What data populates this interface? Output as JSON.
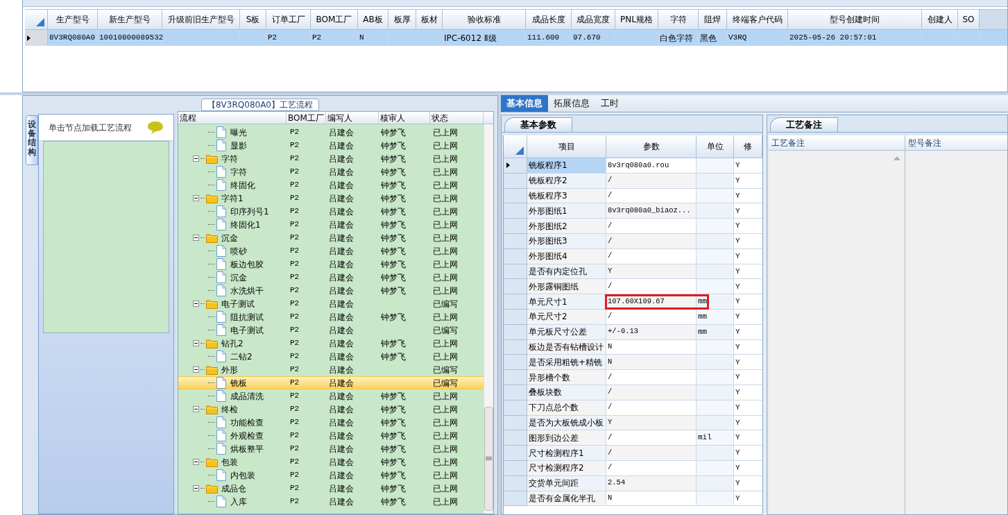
{
  "production_table": {
    "columns": [
      "生产型号",
      "新生产型号",
      "升级前旧生产型号",
      "S板",
      "订单工厂",
      "BOM工厂",
      "AB板",
      "板厚",
      "板材",
      "验收标准",
      "成品长度",
      "成品宽度",
      "PNL规格",
      "字符",
      "阻焊",
      "终端客户代码",
      "型号创建时间",
      "创建人",
      "SO"
    ],
    "rows": [
      {
        "selected": true,
        "cells": [
          "8V3RQ080A0",
          "10010800089532",
          null,
          null,
          "P2",
          "P2",
          "N",
          null,
          null,
          "IPC-6012 Ⅱ级",
          "111.600",
          "97.670",
          null,
          "白色字符",
          "黑色",
          "V3RQ",
          "2025-05-26 20:57:01",
          null,
          null
        ]
      }
    ]
  },
  "process_panel": {
    "title": "【8V3RQ080A0】工艺流程",
    "side_tab": "设备结构",
    "hint": "单击节点加载工艺流程",
    "tree_columns": [
      "流程",
      "BOM工厂",
      "编写人",
      "核审人",
      "状态"
    ],
    "tree": [
      {
        "kind": "step",
        "label": "曝光",
        "bom": "P2",
        "author": "吕建会",
        "reviewer": "钟梦飞",
        "status": "已上网",
        "selected": false
      },
      {
        "kind": "step",
        "label": "显影",
        "bom": "P2",
        "author": "吕建会",
        "reviewer": "钟梦飞",
        "status": "已上网",
        "selected": false
      },
      {
        "kind": "folder",
        "label": "字符",
        "bom": "P2",
        "author": "吕建会",
        "reviewer": "钟梦飞",
        "status": "已上网",
        "selected": false,
        "expanded": true,
        "children": [
          {
            "kind": "step",
            "label": "字符",
            "bom": "P2",
            "author": "吕建会",
            "reviewer": "钟梦飞",
            "status": "已上网",
            "selected": false
          },
          {
            "kind": "step",
            "label": "终固化",
            "bom": "P2",
            "author": "吕建会",
            "reviewer": "钟梦飞",
            "status": "已上网",
            "selected": false
          }
        ]
      },
      {
        "kind": "folder",
        "label": "字符1",
        "bom": "P2",
        "author": "吕建会",
        "reviewer": "钟梦飞",
        "status": "已上网",
        "selected": false,
        "expanded": true,
        "children": [
          {
            "kind": "step",
            "label": "印序列号1",
            "bom": "P2",
            "author": "吕建会",
            "reviewer": "钟梦飞",
            "status": "已上网",
            "selected": false
          },
          {
            "kind": "step",
            "label": "终固化1",
            "bom": "P2",
            "author": "吕建会",
            "reviewer": "钟梦飞",
            "status": "已上网",
            "selected": false
          }
        ]
      },
      {
        "kind": "folder",
        "label": "沉金",
        "bom": "P2",
        "author": "吕建会",
        "reviewer": "钟梦飞",
        "status": "已上网",
        "selected": false,
        "expanded": true,
        "children": [
          {
            "kind": "step",
            "label": "喷砂",
            "bom": "P2",
            "author": "吕建会",
            "reviewer": "钟梦飞",
            "status": "已上网",
            "selected": false
          },
          {
            "kind": "step",
            "label": "板边包胶",
            "bom": "P2",
            "author": "吕建会",
            "reviewer": "钟梦飞",
            "status": "已上网",
            "selected": false
          },
          {
            "kind": "step",
            "label": "沉金",
            "bom": "P2",
            "author": "吕建会",
            "reviewer": "钟梦飞",
            "status": "已上网",
            "selected": false
          },
          {
            "kind": "step",
            "label": "水洗烘干",
            "bom": "P2",
            "author": "吕建会",
            "reviewer": "钟梦飞",
            "status": "已上网",
            "selected": false
          }
        ]
      },
      {
        "kind": "folder",
        "label": "电子测试",
        "bom": "P2",
        "author": "吕建会",
        "status": "已编写",
        "selected": false,
        "expanded": true,
        "children": [
          {
            "kind": "step",
            "label": "阻抗测试",
            "bom": "P2",
            "author": "吕建会",
            "reviewer": "钟梦飞",
            "status": "已上网",
            "selected": false
          },
          {
            "kind": "step",
            "label": "电子测试",
            "bom": "P2",
            "author": "吕建会",
            "status": "已编写",
            "selected": false
          }
        ]
      },
      {
        "kind": "folder",
        "label": "钻孔2",
        "bom": "P2",
        "author": "吕建会",
        "reviewer": "钟梦飞",
        "status": "已上网",
        "selected": false,
        "expanded": true,
        "children": [
          {
            "kind": "step",
            "label": "二钻2",
            "bom": "P2",
            "author": "吕建会",
            "reviewer": "钟梦飞",
            "status": "已上网",
            "selected": false
          }
        ]
      },
      {
        "kind": "folder",
        "label": "外形",
        "bom": "P2",
        "author": "吕建会",
        "status": "已编写",
        "selected": false,
        "expanded": true,
        "children": [
          {
            "kind": "step",
            "label": "铣板",
            "bom": "P2",
            "author": "吕建会",
            "status": "已编写",
            "selected": true
          },
          {
            "kind": "step",
            "label": "成品清洗",
            "bom": "P2",
            "author": "吕建会",
            "reviewer": "钟梦飞",
            "status": "已上网",
            "selected": false
          }
        ]
      },
      {
        "kind": "folder",
        "label": "终检",
        "bom": "P2",
        "author": "吕建会",
        "reviewer": "钟梦飞",
        "status": "已上网",
        "selected": false,
        "expanded": true,
        "children": [
          {
            "kind": "step",
            "label": "功能检查",
            "bom": "P2",
            "author": "吕建会",
            "reviewer": "钟梦飞",
            "status": "已上网",
            "selected": false
          },
          {
            "kind": "step",
            "label": "外观检查",
            "bom": "P2",
            "author": "吕建会",
            "reviewer": "钟梦飞",
            "status": "已上网",
            "selected": false
          },
          {
            "kind": "step",
            "label": "烘板整平",
            "bom": "P2",
            "author": "吕建会",
            "reviewer": "钟梦飞",
            "status": "已上网",
            "selected": false
          }
        ]
      },
      {
        "kind": "folder",
        "label": "包装",
        "bom": "P2",
        "author": "吕建会",
        "reviewer": "钟梦飞",
        "status": "已上网",
        "selected": false,
        "expanded": true,
        "children": [
          {
            "kind": "step",
            "label": "内包装",
            "bom": "P2",
            "author": "吕建会",
            "reviewer": "钟梦飞",
            "status": "已上网",
            "selected": false
          }
        ]
      },
      {
        "kind": "folder",
        "label": "成品仓",
        "bom": "P2",
        "author": "吕建会",
        "reviewer": "钟梦飞",
        "status": "已上网",
        "selected": false,
        "expanded": true,
        "children": [
          {
            "kind": "step",
            "label": "入库",
            "bom": "P2",
            "author": "吕建会",
            "reviewer": "钟梦飞",
            "status": "已上网",
            "selected": false
          }
        ]
      }
    ]
  },
  "detail_tabs": [
    {
      "label": "基本信息",
      "selected": true
    },
    {
      "label": "拓展信息",
      "selected": false
    },
    {
      "label": "工时",
      "selected": false
    }
  ],
  "params_panel": {
    "tab": "基本参数",
    "columns": [
      "项目",
      "参数",
      "单位",
      "修"
    ],
    "rows": [
      {
        "item": "铣板程序1",
        "value": "8v3rq080a0.rou",
        "modified": "Y",
        "selected": true,
        "highlighted": false
      },
      {
        "item": "铣板程序2",
        "value": "/",
        "modified": "Y",
        "selected": false,
        "highlighted": false
      },
      {
        "item": "铣板程序3",
        "value": "/",
        "modified": "Y",
        "selected": false,
        "highlighted": false
      },
      {
        "item": "外形图纸1",
        "value": "8v3rq080a0_biaoz...",
        "modified": "Y",
        "selected": false,
        "highlighted": false
      },
      {
        "item": "外形图纸2",
        "value": "/",
        "modified": "Y",
        "selected": false,
        "highlighted": false
      },
      {
        "item": "外形图纸3",
        "value": "/",
        "modified": "Y",
        "selected": false,
        "highlighted": false
      },
      {
        "item": "外形图纸4",
        "value": "/",
        "modified": "Y",
        "selected": false,
        "highlighted": false
      },
      {
        "item": "是否有内定位孔",
        "value": "Y",
        "modified": "Y",
        "selected": false,
        "highlighted": false
      },
      {
        "item": "外形露铜图纸",
        "value": "/",
        "modified": "Y",
        "selected": false,
        "highlighted": false
      },
      {
        "item": "单元尺寸1",
        "value": "107.60X109.67",
        "unit": "mm",
        "modified": "Y",
        "selected": false,
        "highlighted": true
      },
      {
        "item": "单元尺寸2",
        "value": "/",
        "unit": "mm",
        "modified": "Y",
        "selected": false,
        "highlighted": false
      },
      {
        "item": "单元板尺寸公差",
        "value": "+/-0.13",
        "unit": "mm",
        "modified": "Y",
        "selected": false,
        "highlighted": false
      },
      {
        "item": "板边是否有钻槽设计",
        "value": "N",
        "modified": "Y",
        "selected": false,
        "highlighted": false
      },
      {
        "item": "是否采用粗铣+精铣",
        "value": "N",
        "modified": "Y",
        "selected": false,
        "highlighted": false
      },
      {
        "item": "异形槽个数",
        "value": "/",
        "modified": "Y",
        "selected": false,
        "highlighted": false
      },
      {
        "item": "叠板块数",
        "value": "/",
        "modified": "Y",
        "selected": false,
        "highlighted": false
      },
      {
        "item": "下刀点总个数",
        "value": "/",
        "modified": "Y",
        "selected": false,
        "highlighted": false
      },
      {
        "item": "是否为大板铣成小板",
        "value": "Y",
        "modified": "Y",
        "selected": false,
        "highlighted": false
      },
      {
        "item": "图形到边公差",
        "value": "/",
        "unit": "mil",
        "modified": "Y",
        "selected": false,
        "highlighted": false
      },
      {
        "item": "尺寸检测程序1",
        "value": "/",
        "modified": "Y",
        "selected": false,
        "highlighted": false
      },
      {
        "item": "尺寸检测程序2",
        "value": "/",
        "modified": "Y",
        "selected": false,
        "highlighted": false
      },
      {
        "item": "交货单元间距",
        "value": "2.54",
        "modified": "Y",
        "selected": false,
        "highlighted": false
      },
      {
        "item": "是否有金属化半孔",
        "value": "N",
        "modified": "Y",
        "selected": false,
        "highlighted": false
      }
    ]
  },
  "notes_panel": {
    "tab": "工艺备注",
    "columns": [
      "工艺备注",
      "型号备注"
    ]
  }
}
